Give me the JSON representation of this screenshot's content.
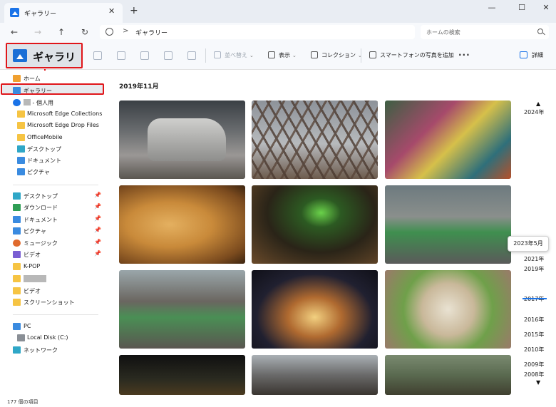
{
  "tab": {
    "title": "ギャラリー",
    "close": "✕",
    "new": "+"
  },
  "window": {
    "minimize": "—",
    "maximize": "☐",
    "close": "✕"
  },
  "nav": {
    "back": "←",
    "forward": "→",
    "up": "↑",
    "refresh": "↻"
  },
  "address": {
    "separator": ">",
    "path": "ギャラリー"
  },
  "search": {
    "placeholder": "ホームの検索"
  },
  "header": {
    "title": "ギャラリー"
  },
  "toolbar": {
    "sort_label": "並べ替え",
    "view_label": "表示",
    "collection_label": "コレクション",
    "phone_label": "スマートフォンの写真を追加",
    "more_label": "···",
    "details_label": "詳細",
    "chevron": "⌄"
  },
  "sidebar": {
    "home": "ホーム",
    "gallery": "ギャラリー",
    "personal_suffix": " - 個人用",
    "onedrive_folders": [
      "Microsoft Edge Collections",
      "Microsoft Edge Drop Files",
      "OfficeMobile",
      "デスクトップ",
      "ドキュメント",
      "ピクチャ"
    ],
    "quick": [
      "デスクトップ",
      "ダウンロード",
      "ドキュメント",
      "ピクチャ",
      "ミュージック",
      "ビデオ",
      "K-POP",
      "",
      "ビデオ",
      "スクリーンショット"
    ],
    "pc": "PC",
    "disk": "Local Disk (C:)",
    "network": "ネットワーク",
    "pin": "📌"
  },
  "status": {
    "item_count": "177 個の項目"
  },
  "main": {
    "month_heading": "2019年11月"
  },
  "timeline": {
    "up": "▲",
    "down": "▼",
    "popup": "2023年5月",
    "years": [
      "2024年",
      "2021年",
      "2019年",
      "2017年",
      "2016年",
      "2015年",
      "2010年",
      "2009年",
      "2008年"
    ]
  },
  "photos": [
    "street-car",
    "iron-bridge",
    "market-bags",
    "banh-mi",
    "green-lamp-cafe",
    "grab-rider",
    "motorbike-street",
    "night-building",
    "pho-bowl",
    "night-street",
    "market-alley",
    "tree-street"
  ],
  "colors": {
    "accent": "#1a73e8",
    "highlight_red": "#e0161a"
  }
}
